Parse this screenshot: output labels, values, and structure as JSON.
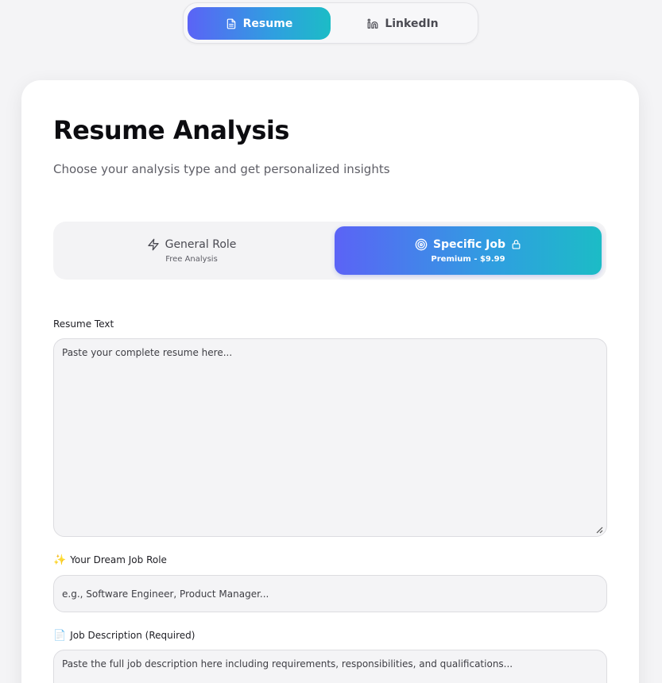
{
  "top_tabs": {
    "resume_label": "Resume",
    "linkedin_label": "LinkedIn"
  },
  "page": {
    "title": "Resume Analysis",
    "subtitle": "Choose your analysis type and get personalized insights"
  },
  "analysis_type": {
    "general": {
      "label": "General Role",
      "sub": "Free Analysis"
    },
    "specific": {
      "label": "Specific Job",
      "sub": "Premium - $9.99"
    }
  },
  "form": {
    "resume_label": "Resume Text",
    "resume_placeholder": "Paste your complete resume here...",
    "dream_icon": "✨",
    "dream_label": "Your Dream Job Role",
    "dream_placeholder": "e.g., Software Engineer, Product Manager...",
    "jd_icon": "📄",
    "jd_label": "Job Description (Required)",
    "jd_placeholder": "Paste the full job description here including requirements, responsibilities, and qualifications..."
  },
  "colors": {
    "gradient_start": "#5b63f6",
    "gradient_end": "#1cbcc6",
    "background": "#f4f4f6"
  }
}
